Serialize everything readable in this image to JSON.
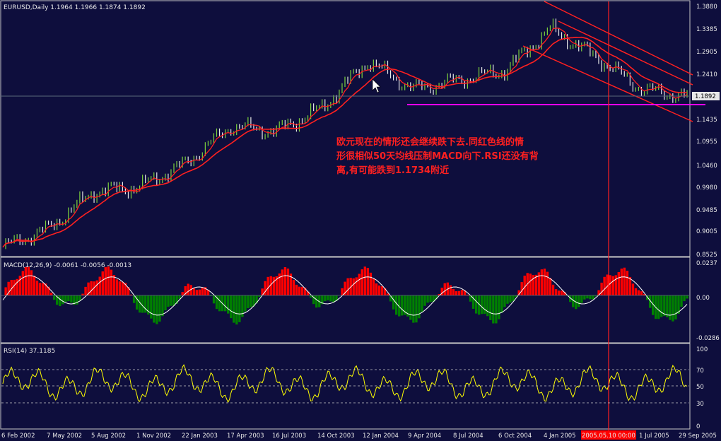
{
  "colors": {
    "background": "#0e0e3d",
    "frame": "#c8c8c8",
    "price": "#e8e8e8",
    "ma_fast": "#ff2020",
    "macd_pos": "#ff0000",
    "macd_neg": "#008000",
    "rsi": "#ffff00",
    "trend": "#ff2020",
    "support": "#ff00ff",
    "cursor": "#ff2020"
  },
  "price_panel": {
    "header": "EURUSD,Daily  1.1964 1.1966 1.1874 1.1892",
    "last_price": "1.1892",
    "ticks": [
      "1.3880",
      "1.3385",
      "1.2905",
      "1.2410",
      "1.1892",
      "1.1435",
      "1.0955",
      "1.0460",
      "0.9980",
      "0.9485",
      "0.9005",
      "0.8525"
    ],
    "annotation": [
      "欧元现在的情形还会继续跌下去.同红色线的情",
      "形很相似50天均线压制MACD向下.RSI还没有背",
      "离,有可能跌到1.1734附近"
    ]
  },
  "macd_panel": {
    "header": "MACD(12,26,9) -0.0061 -0.0056 -0.0013",
    "ticks": [
      "0.0237",
      "0.00",
      "-0.0286"
    ]
  },
  "rsi_panel": {
    "header": "RSI(14) 37.1185",
    "ticks": [
      "100",
      "70",
      "50",
      "30",
      "0"
    ]
  },
  "time_axis": {
    "labels": [
      "6 Feb 2002",
      "7 May 2002",
      "5 Aug 2002",
      "1 Nov 2002",
      "22 Jan 2003",
      "17 Apr 2003",
      "16 Jul 2003",
      "14 Oct 2003",
      "12 Jan 2004",
      "9 Apr 2004",
      "8 Jul 2004",
      "6 Oct 2004",
      "4 Jan 2005",
      "2005.05.10 00:00",
      "1 Jul 2005",
      "29 Sep 2005"
    ]
  },
  "chart_data": {
    "type": "line",
    "title": "EURUSD,Daily",
    "x": [
      "6 Feb 2002",
      "7 May 2002",
      "5 Aug 2002",
      "1 Nov 2002",
      "22 Jan 2003",
      "17 Apr 2003",
      "16 Jul 2003",
      "14 Oct 2003",
      "12 Jan 2004",
      "9 Apr 2004",
      "8 Jul 2004",
      "6 Oct 2004",
      "4 Jan 2005",
      "2005.05.10",
      "1 Jul 2005",
      "29 Sep 2005"
    ],
    "series": [
      {
        "name": "EURUSD",
        "values": [
          0.865,
          0.905,
          0.985,
          0.995,
          1.045,
          1.125,
          1.115,
          1.165,
          1.265,
          1.205,
          1.225,
          1.245,
          1.335,
          1.275,
          1.205,
          1.1892
        ]
      }
    ],
    "ylim": [
      0.8525,
      1.388
    ]
  }
}
